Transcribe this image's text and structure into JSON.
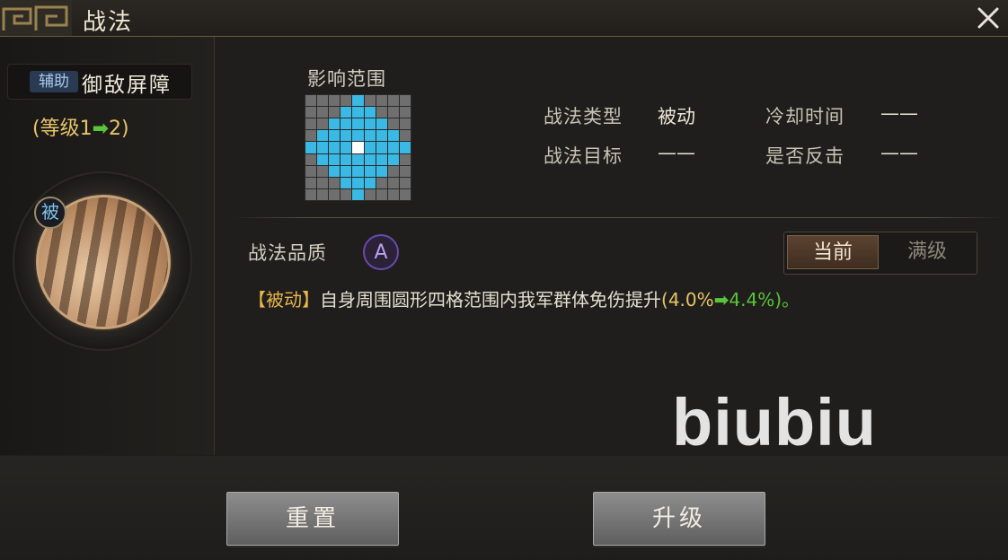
{
  "window": {
    "title": "战法"
  },
  "skill": {
    "tag": "辅助",
    "name": "御敌屏障",
    "level": {
      "prefix": "(等级",
      "from": "1",
      "arrow": "➡",
      "to": "2",
      "suffix": ")"
    },
    "passive_badge": "被"
  },
  "range": {
    "label": "影响范围",
    "rows": [
      [
        0,
        0,
        0,
        0,
        1,
        0,
        0,
        0,
        0
      ],
      [
        0,
        0,
        0,
        1,
        1,
        1,
        0,
        0,
        0
      ],
      [
        0,
        0,
        1,
        1,
        1,
        1,
        1,
        0,
        0
      ],
      [
        0,
        1,
        1,
        1,
        1,
        1,
        1,
        1,
        0
      ],
      [
        1,
        1,
        1,
        1,
        2,
        1,
        1,
        1,
        1
      ],
      [
        0,
        1,
        1,
        1,
        1,
        1,
        1,
        1,
        0
      ],
      [
        0,
        0,
        1,
        1,
        1,
        1,
        1,
        0,
        0
      ],
      [
        0,
        0,
        0,
        1,
        1,
        1,
        0,
        0,
        0
      ],
      [
        0,
        0,
        0,
        0,
        1,
        0,
        0,
        0,
        0
      ]
    ]
  },
  "info": {
    "type_label": "战法类型",
    "type_value": "被动",
    "cooldown_label": "冷却时间",
    "cooldown_value": "——",
    "target_label": "战法目标",
    "target_value": "——",
    "counter_label": "是否反击",
    "counter_value": "——"
  },
  "quality": {
    "label": "战法品质",
    "grade": "A"
  },
  "toggle": {
    "current": "当前",
    "max": "满级"
  },
  "description": {
    "tag": "【被动】",
    "text": "自身周围圆形四格范围内我军群体免伤提升",
    "open": "(",
    "old": "4.0%",
    "arrow": "➡",
    "new": "4.4%",
    "close": ")。"
  },
  "watermark": "biubiu",
  "buttons": {
    "reset": "重置",
    "upgrade": "升级"
  },
  "colors": {
    "range_on": "#39b9e4",
    "range_off": "#6f6f6f",
    "accent_gold": "#e6c46a",
    "arrow_green": "#5ac43a"
  }
}
